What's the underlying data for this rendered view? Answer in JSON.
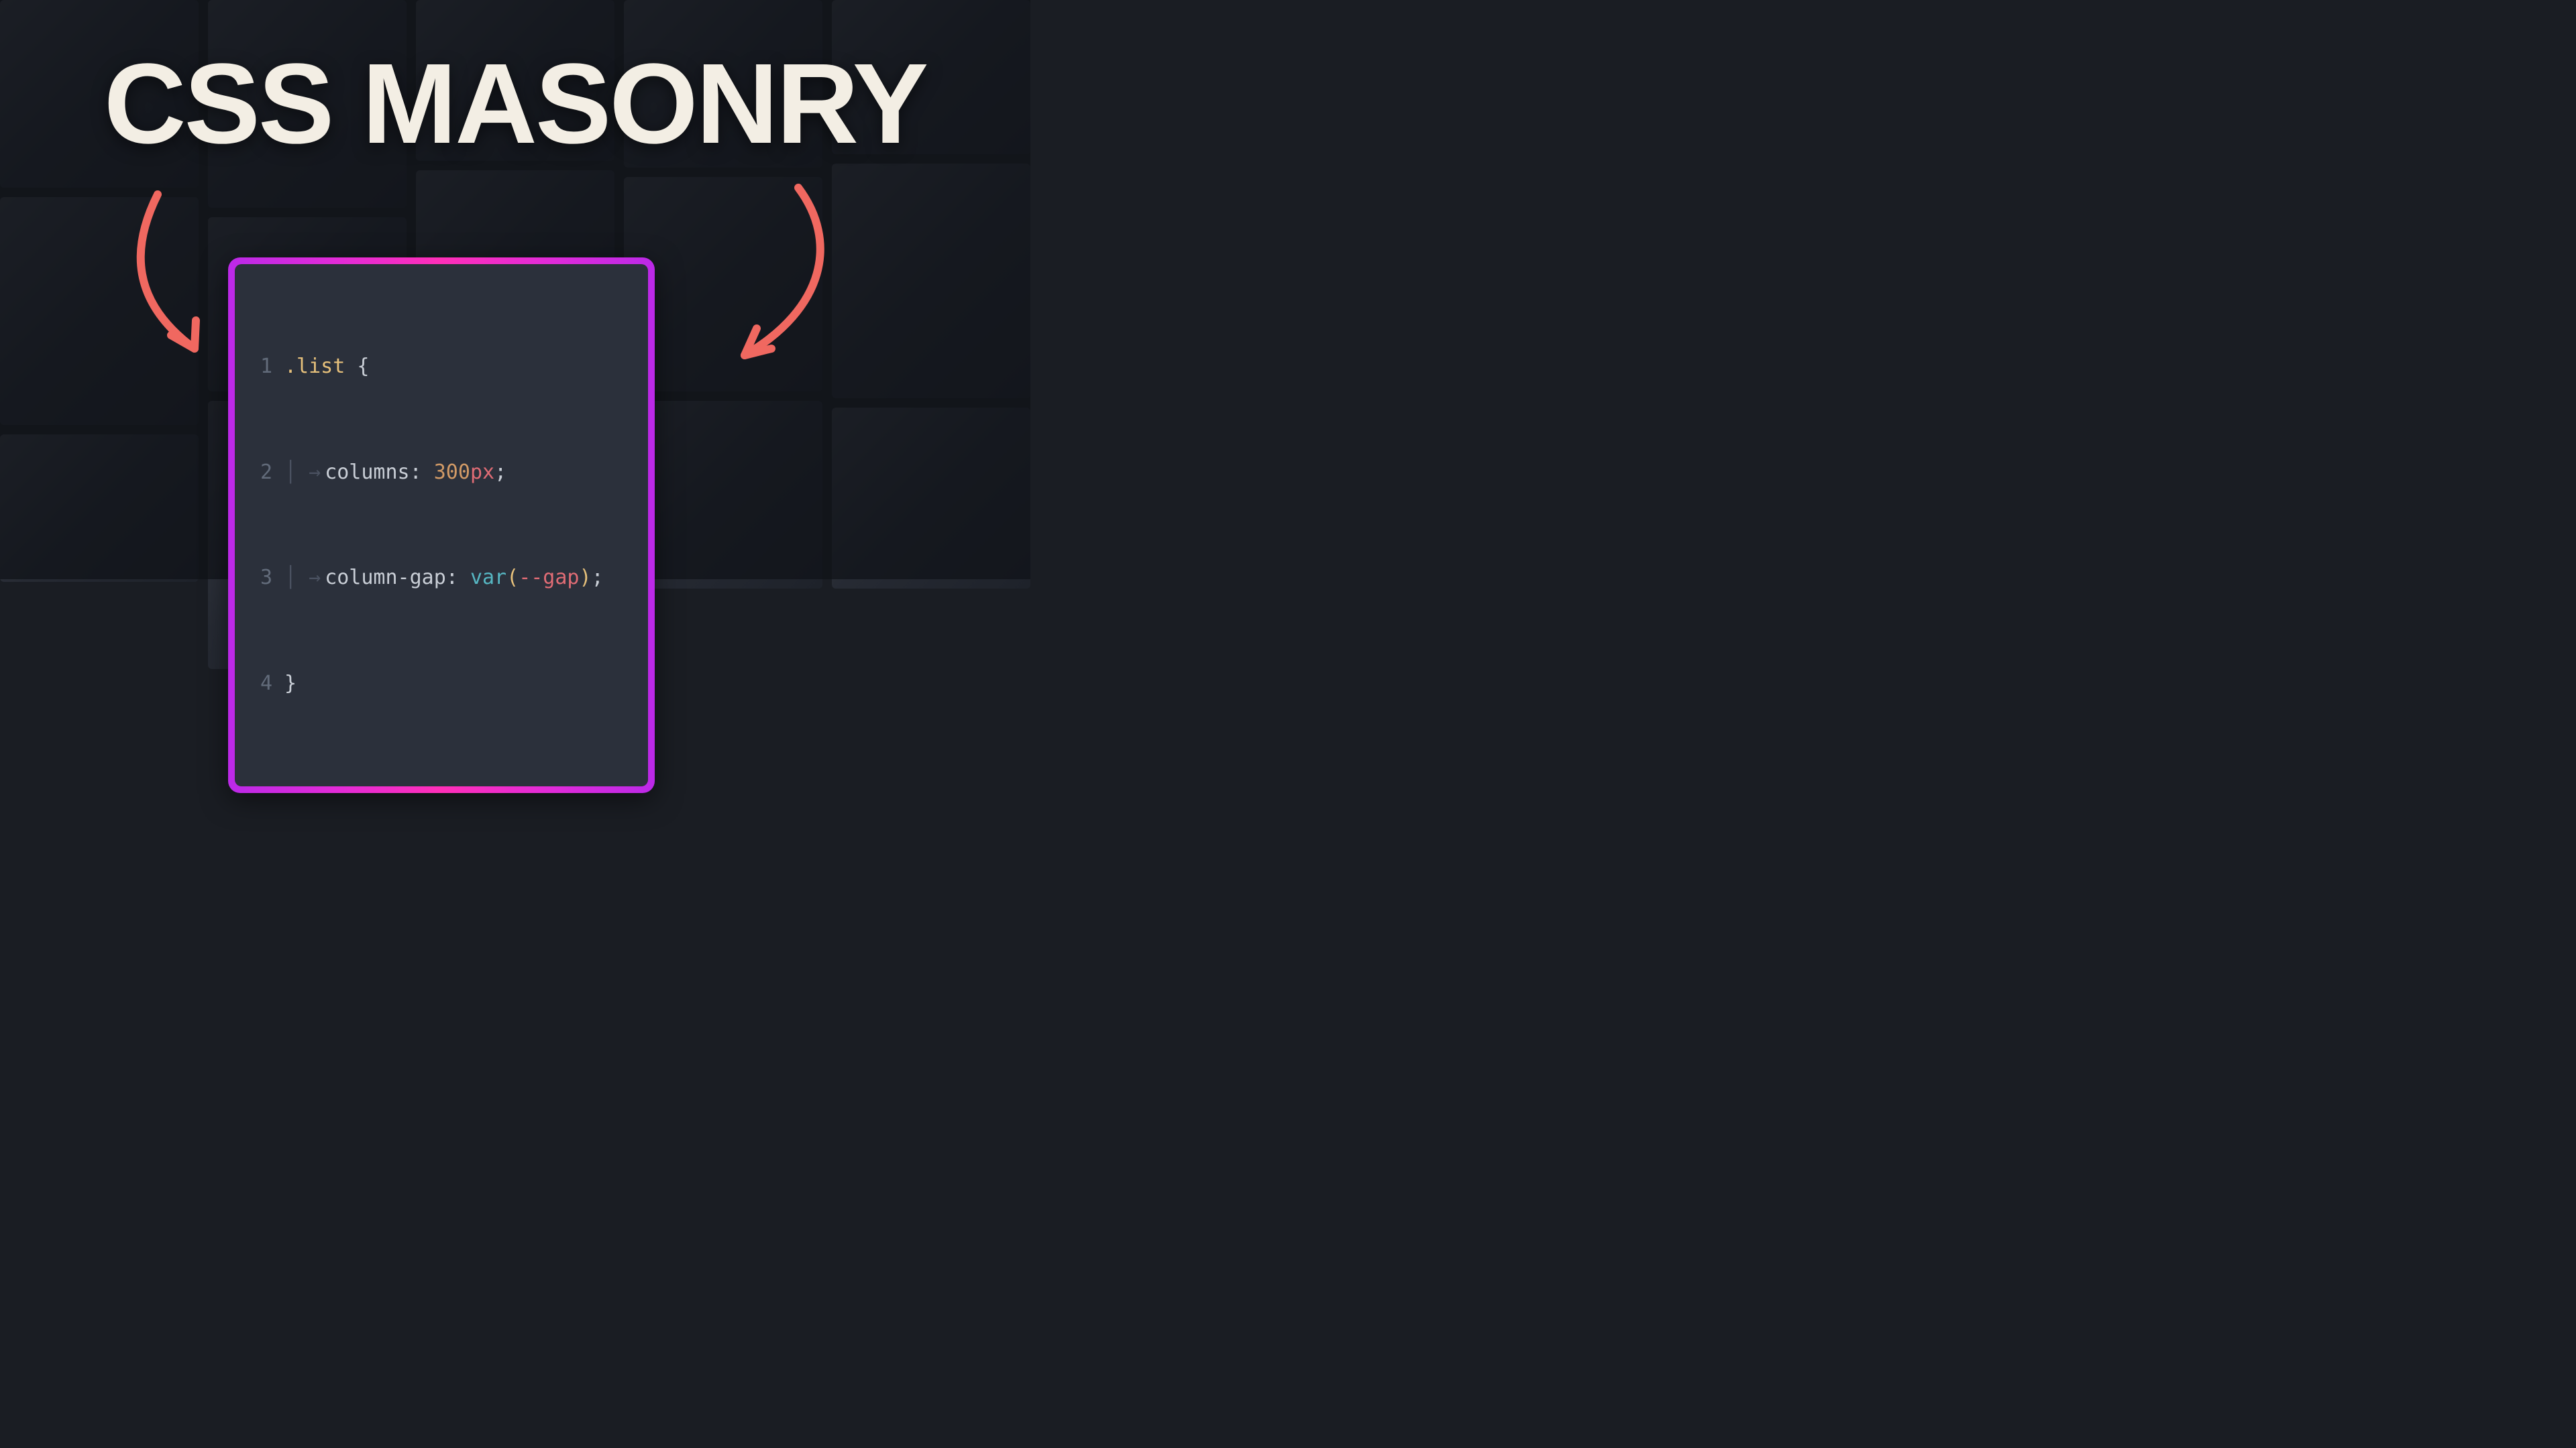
{
  "title": "CSS MASONRY",
  "code": {
    "lines": [
      "1",
      "2",
      "3",
      "4"
    ],
    "selector": ".list",
    "brace_open": "{",
    "brace_close": "}",
    "prop1": "columns",
    "colon": ":",
    "val1_num": "300",
    "val1_unit": "px",
    "semi": ";",
    "prop2": "column-gap",
    "fn": "var",
    "paren_open": "(",
    "varname": "--gap",
    "paren_close": ")"
  },
  "arrows": {
    "color": "#f06860"
  },
  "bg_tile_heights": [
    280,
    340,
    220,
    310,
    260,
    400,
    240,
    300,
    360,
    250,
    320,
    280,
    230,
    350,
    270
  ]
}
